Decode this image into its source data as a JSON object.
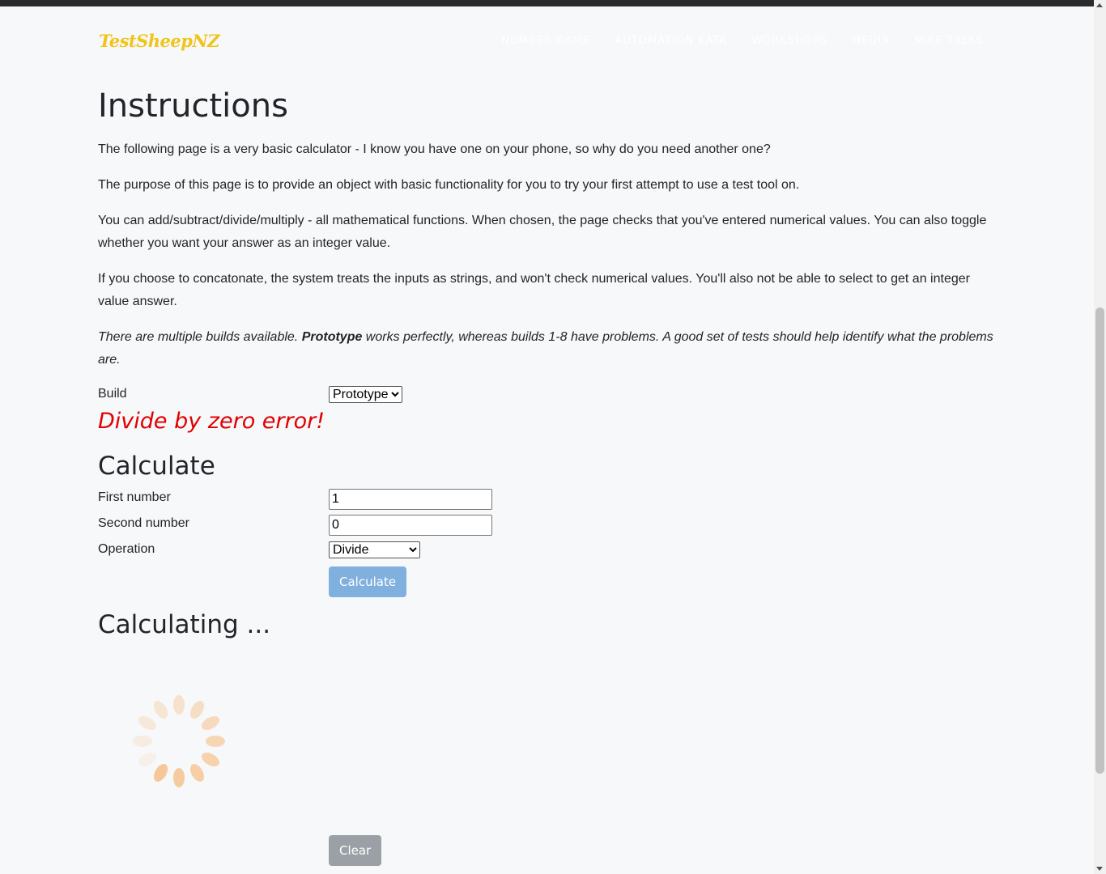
{
  "navbar": {
    "brand": "TestSheepNZ",
    "links": [
      "NUMBER GAME",
      "AUTOMATION KATA",
      "WORKSHOPS",
      "MEDIA",
      "MIKE TALKS"
    ]
  },
  "instructions": {
    "title": "Instructions",
    "p1": "The following page is a very basic calculator - I know you have one on your phone, so why do you need another one?",
    "p2": "The purpose of this page is to provide an object with basic functionality for you to try your first attempt to use a test tool on.",
    "p3": "You can add/subtract/divide/multiply - all mathematical functions. When chosen, the page checks that you've entered numerical values. You can also toggle whether you want your answer as an integer value.",
    "p4": "If you choose to concatonate, the system treats the inputs as strings, and won't check numerical values. You'll also not be able to select to get an integer value answer.",
    "p5_a": "There are multiple builds available. ",
    "p5_bold": "Prototype",
    "p5_b": " works perfectly, whereas builds 1-8 have problems. A good set of tests should help identify what the problems are."
  },
  "build": {
    "label": "Build",
    "selected": "Prototype"
  },
  "error_message": "Divide by zero error!",
  "calculate": {
    "heading": "Calculate",
    "first_label": "First number",
    "first_value": "1",
    "second_label": "Second number",
    "second_value": "0",
    "operation_label": "Operation",
    "operation_selected": "Divide",
    "button": "Calculate"
  },
  "calculating": {
    "heading": "Calculating ..."
  },
  "clear_button": "Clear",
  "colors": {
    "error": "#e10000",
    "calc_button": "#7fb0de",
    "clear_button": "#9aa0a6",
    "brand": "#f0c419",
    "spinner": "#f6c48f"
  }
}
